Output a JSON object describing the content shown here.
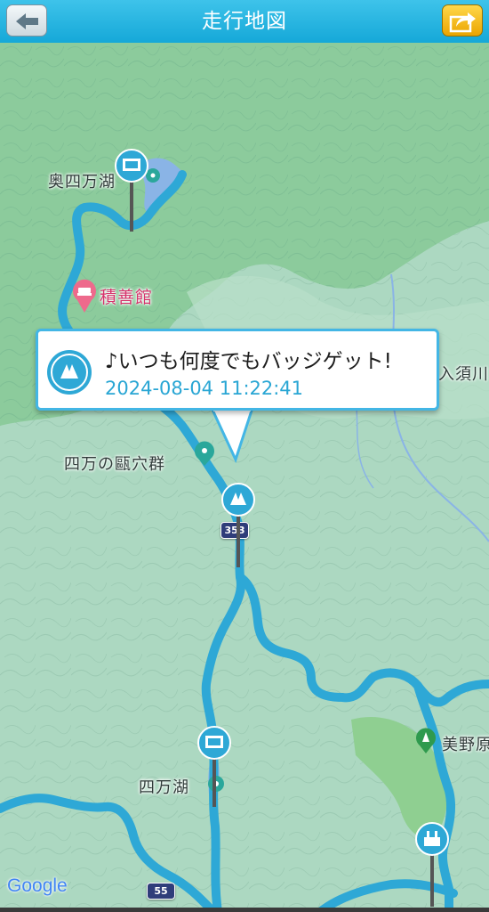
{
  "header": {
    "title": "走行地図",
    "back_icon": "back-arrow-icon",
    "share_icon": "share-icon"
  },
  "colors": {
    "header": "#15a8d8",
    "route": "#2ea8d6",
    "share_button": "#eba400",
    "popup_border": "#43b6e5",
    "poi_pink": "#d6336c"
  },
  "map_labels": {
    "oku_shima_lake": "奥四万湖",
    "sekizenkan": "積善館",
    "irisugawa": "入須川",
    "shima_kettle": "四万の甌穴群",
    "shima_lake": "四万湖",
    "mino": "美野原"
  },
  "route_badges": {
    "r353": "353",
    "r55": "55"
  },
  "popup": {
    "title": "♪いつも何度でもバッジゲット!",
    "timestamp": "2024-08-04 11:22:41"
  },
  "attribution": {
    "google": "Google"
  }
}
